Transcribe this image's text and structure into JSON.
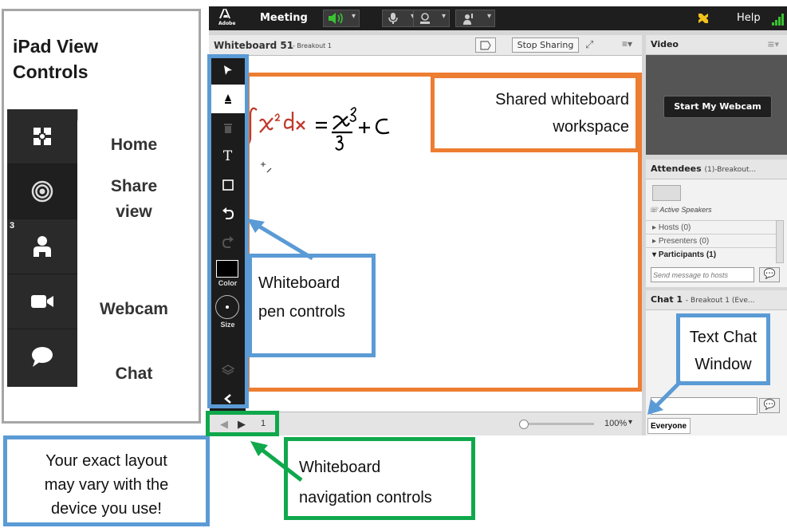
{
  "ipad": {
    "title_line1": "iPad View",
    "title_line2": "Controls",
    "items": [
      {
        "label": "Home",
        "icon": "home-icon"
      },
      {
        "label": "Share view",
        "line1": "Share",
        "line2": "view",
        "icon": "share-view-icon"
      },
      {
        "label": "",
        "badge": "3",
        "icon": "attendees-icon"
      },
      {
        "label": "Webcam",
        "icon": "webcam-icon"
      },
      {
        "label": "Chat",
        "icon": "chat-icon"
      }
    ]
  },
  "app": {
    "logo": "Adobe",
    "menu_meeting": "Meeting",
    "menu_help": "Help",
    "whiteboard_title": "Whiteboard 51",
    "whiteboard_breakout": "- Breakout 1",
    "stop_sharing": "Stop Sharing",
    "tools": {
      "text_tool": "T",
      "color_label": "Color",
      "size_label": "Size"
    },
    "formula": "∫x²dx = x³/3 + C",
    "page_number": "1",
    "zoom": "100%",
    "video_title": "Video",
    "start_webcam": "Start My Webcam",
    "attendees_title": "Attendees",
    "attendees_count": "(1)-Breakout...",
    "active_speakers": "Active Speakers",
    "hosts": "Hosts (0)",
    "presenters": "Presenters (0)",
    "participants": "Participants (1)",
    "send_to_hosts_placeholder": "Send message to hosts",
    "chat_title": "Chat 1",
    "chat_breakout": "- Breakout 1 (Eve...",
    "chat_tab": "Everyone"
  },
  "callouts": {
    "shared_line1": "Shared whiteboard",
    "shared_line2": "workspace",
    "pen_line1": "Whiteboard",
    "pen_line2": "pen controls",
    "chat_line1": "Text Chat",
    "chat_line2": "Window",
    "layout_line1": "Your exact layout",
    "layout_line2": "may vary with the",
    "layout_line3": "device you use!",
    "nav_line1": "Whiteboard",
    "nav_line2": "navigation controls"
  },
  "colors": {
    "blue": "#5b9bd5",
    "orange": "#ed7d31",
    "green": "#10a84c",
    "ink": "#c0392b"
  }
}
